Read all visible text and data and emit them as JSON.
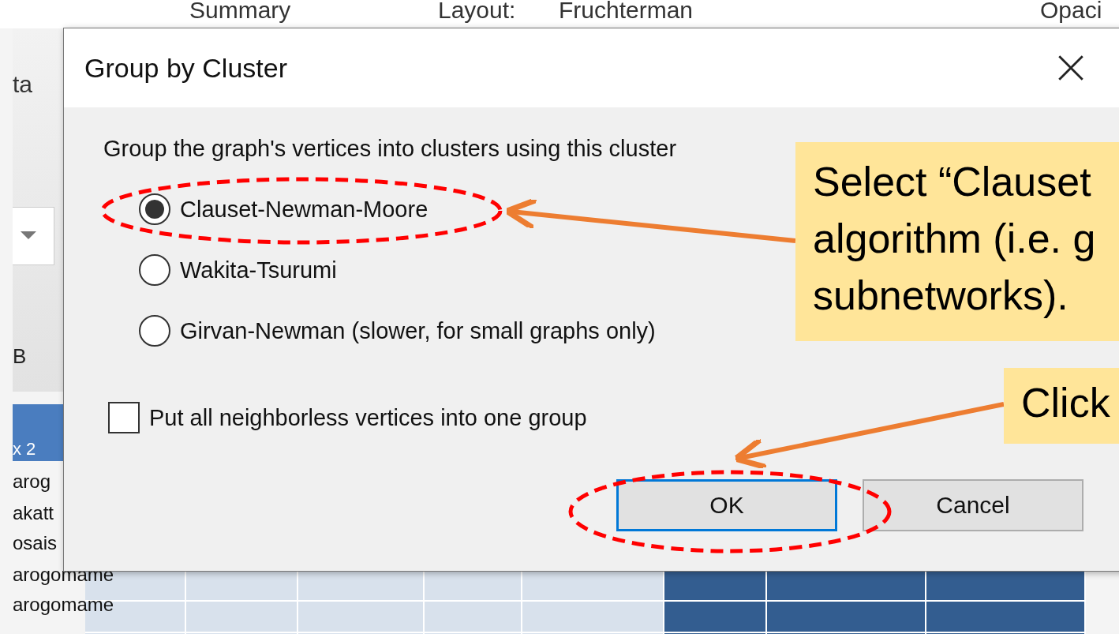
{
  "background_app": {
    "ribbon": [
      {
        "kind": "sum",
        "text": "Summary"
      },
      {
        "kind": "layout",
        "text": "Layout:"
      },
      {
        "kind": "combo",
        "text": "Fruchterman"
      },
      {
        "kind": "opacity",
        "text": "Opaci"
      }
    ],
    "side_menu": "ta",
    "column_letter": "B",
    "column_header": "x 2",
    "rows": [
      "arog",
      "akatt",
      "osais",
      "arogomame",
      "arogomame"
    ]
  },
  "dialog": {
    "title": "Group by Cluster",
    "prompt": "Group the graph's vertices into clusters using this cluster",
    "options": [
      {
        "label": "Clauset-Newman-Moore",
        "selected": true
      },
      {
        "label": "Wakita-Tsurumi",
        "selected": false
      },
      {
        "label": "Girvan-Newman (slower, for small graphs only)",
        "selected": false
      }
    ],
    "checkbox": {
      "label": "Put all neighborless vertices into one group",
      "checked": false
    },
    "buttons": [
      {
        "label": "OK",
        "default": true
      },
      {
        "label": "Cancel",
        "default": false
      }
    ]
  },
  "callouts": [
    {
      "lines": [
        "Select “Clauset",
        "algorithm (i.e. g",
        "subnetworks)."
      ]
    },
    {
      "lines": [
        "Click"
      ]
    }
  ]
}
